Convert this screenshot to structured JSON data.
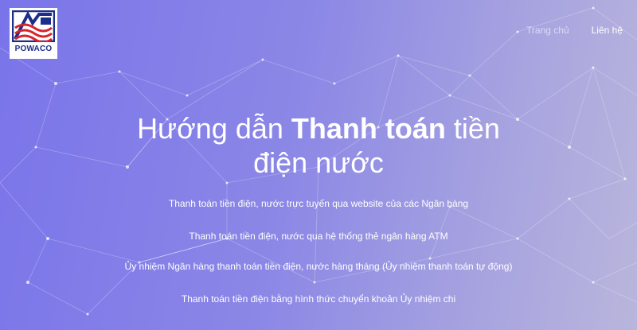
{
  "brand": {
    "logo_text": "POWACO",
    "logo_colors": {
      "blue": "#1c2d8a",
      "red": "#d8232a"
    }
  },
  "nav": {
    "home_label": "Trang chủ",
    "contact_label": "Liên hệ"
  },
  "hero": {
    "title_part1": "Hướng dẫn ",
    "title_bold": "Thanh toán",
    "title_part2": " tiền",
    "title_line2": "điện nước"
  },
  "links": [
    {
      "label": "Thanh toán tiền điện, nước trực tuyến qua website của các Ngân hàng"
    },
    {
      "label": "Thanh toán tiền điện, nước qua hệ thống thẻ ngân hàng ATM"
    },
    {
      "label": "Ủy nhiệm Ngân hàng thanh toán tiền điện, nước hàng tháng (Ủy nhiệm thanh toán tự động)"
    },
    {
      "label": "Thanh toán tiền điện bằng hình thức chuyển khoản Ủy nhiệm chi"
    }
  ],
  "colors": {
    "background_start": "#7a74ea",
    "background_end": "#b9b6dc",
    "text": "#ffffff"
  }
}
